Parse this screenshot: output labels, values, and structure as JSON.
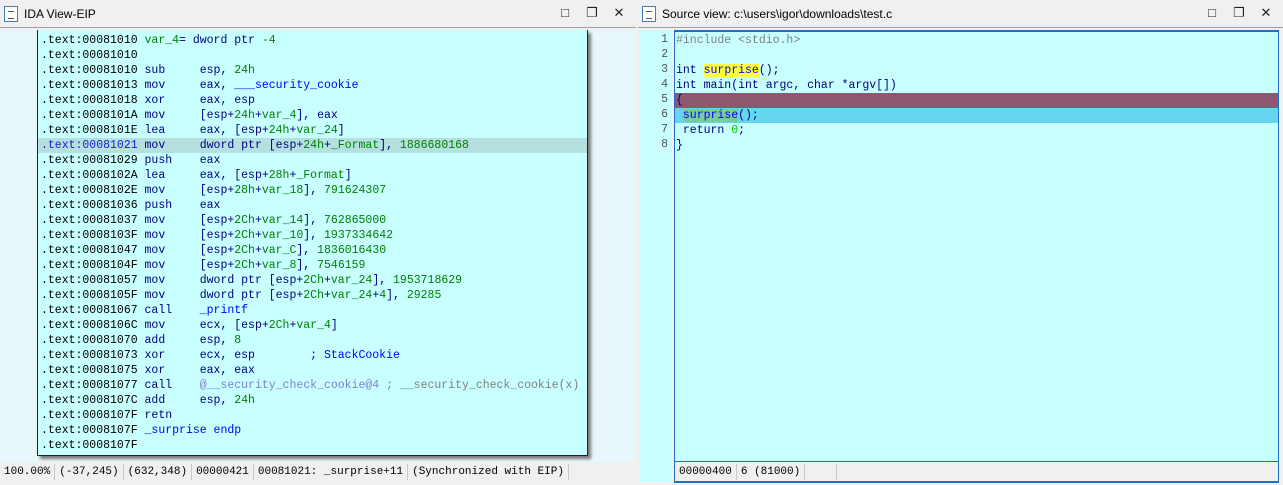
{
  "ida": {
    "title": "IDA View-EIP",
    "lines": [
      {
        "addr": ".text:00081010",
        "mn": "",
        "ops": [
          {
            "t": "var_4",
            "c": "var"
          },
          {
            "t": "= dword ptr ",
            "c": "op"
          },
          {
            "t": "-4",
            "c": "num"
          }
        ]
      },
      {
        "addr": ".text:00081010",
        "mn": "",
        "ops": []
      },
      {
        "addr": ".text:00081010",
        "mn": "sub",
        "ops": [
          {
            "t": "esp, ",
            "c": "op"
          },
          {
            "t": "24h",
            "c": "num"
          }
        ]
      },
      {
        "addr": ".text:00081013",
        "mn": "mov",
        "ops": [
          {
            "t": "eax, ",
            "c": "op"
          },
          {
            "t": "___security_cookie",
            "c": "name"
          }
        ]
      },
      {
        "addr": ".text:00081018",
        "mn": "xor",
        "ops": [
          {
            "t": "eax, esp",
            "c": "op"
          }
        ]
      },
      {
        "addr": ".text:0008101A",
        "mn": "mov",
        "ops": [
          {
            "t": "[esp+",
            "c": "op"
          },
          {
            "t": "24h",
            "c": "num"
          },
          {
            "t": "+",
            "c": "op"
          },
          {
            "t": "var_4",
            "c": "var"
          },
          {
            "t": "], eax",
            "c": "op"
          }
        ]
      },
      {
        "addr": ".text:0008101E",
        "mn": "lea",
        "ops": [
          {
            "t": "eax, [esp+",
            "c": "op"
          },
          {
            "t": "24h",
            "c": "num"
          },
          {
            "t": "+",
            "c": "op"
          },
          {
            "t": "var_24",
            "c": "var"
          },
          {
            "t": "]",
            "c": "op"
          }
        ]
      },
      {
        "addr": ".text:00081021",
        "mn": "mov",
        "hl": true,
        "ops": [
          {
            "t": "dword ptr [esp+",
            "c": "op"
          },
          {
            "t": "24h",
            "c": "num"
          },
          {
            "t": "+",
            "c": "op"
          },
          {
            "t": "_Format",
            "c": "var"
          },
          {
            "t": "], ",
            "c": "op"
          },
          {
            "t": "1886680168",
            "c": "num"
          }
        ]
      },
      {
        "addr": ".text:00081029",
        "mn": "push",
        "ops": [
          {
            "t": "eax",
            "c": "op"
          }
        ]
      },
      {
        "addr": ".text:0008102A",
        "mn": "lea",
        "ops": [
          {
            "t": "eax, [esp+",
            "c": "op"
          },
          {
            "t": "28h",
            "c": "num"
          },
          {
            "t": "+",
            "c": "op"
          },
          {
            "t": "_Format",
            "c": "var"
          },
          {
            "t": "]",
            "c": "op"
          }
        ]
      },
      {
        "addr": ".text:0008102E",
        "mn": "mov",
        "ops": [
          {
            "t": "[esp+",
            "c": "op"
          },
          {
            "t": "28h",
            "c": "num"
          },
          {
            "t": "+",
            "c": "op"
          },
          {
            "t": "var_18",
            "c": "var"
          },
          {
            "t": "], ",
            "c": "op"
          },
          {
            "t": "791624307",
            "c": "num"
          }
        ]
      },
      {
        "addr": ".text:00081036",
        "mn": "push",
        "ops": [
          {
            "t": "eax",
            "c": "op"
          }
        ]
      },
      {
        "addr": ".text:00081037",
        "mn": "mov",
        "ops": [
          {
            "t": "[esp+",
            "c": "op"
          },
          {
            "t": "2Ch",
            "c": "num"
          },
          {
            "t": "+",
            "c": "op"
          },
          {
            "t": "var_14",
            "c": "var"
          },
          {
            "t": "], ",
            "c": "op"
          },
          {
            "t": "762865000",
            "c": "num"
          }
        ]
      },
      {
        "addr": ".text:0008103F",
        "mn": "mov",
        "ops": [
          {
            "t": "[esp+",
            "c": "op"
          },
          {
            "t": "2Ch",
            "c": "num"
          },
          {
            "t": "+",
            "c": "op"
          },
          {
            "t": "var_10",
            "c": "var"
          },
          {
            "t": "], ",
            "c": "op"
          },
          {
            "t": "1937334642",
            "c": "num"
          }
        ]
      },
      {
        "addr": ".text:00081047",
        "mn": "mov",
        "ops": [
          {
            "t": "[esp+",
            "c": "op"
          },
          {
            "t": "2Ch",
            "c": "num"
          },
          {
            "t": "+",
            "c": "op"
          },
          {
            "t": "var_C",
            "c": "var"
          },
          {
            "t": "], ",
            "c": "op"
          },
          {
            "t": "1836016430",
            "c": "num"
          }
        ]
      },
      {
        "addr": ".text:0008104F",
        "mn": "mov",
        "ops": [
          {
            "t": "[esp+",
            "c": "op"
          },
          {
            "t": "2Ch",
            "c": "num"
          },
          {
            "t": "+",
            "c": "op"
          },
          {
            "t": "var_8",
            "c": "var"
          },
          {
            "t": "], ",
            "c": "op"
          },
          {
            "t": "7546159",
            "c": "num"
          }
        ]
      },
      {
        "addr": ".text:00081057",
        "mn": "mov",
        "ops": [
          {
            "t": "dword ptr [esp+",
            "c": "op"
          },
          {
            "t": "2Ch",
            "c": "num"
          },
          {
            "t": "+",
            "c": "op"
          },
          {
            "t": "var_24",
            "c": "var"
          },
          {
            "t": "], ",
            "c": "op"
          },
          {
            "t": "1953718629",
            "c": "num"
          }
        ]
      },
      {
        "addr": ".text:0008105F",
        "mn": "mov",
        "ops": [
          {
            "t": "dword ptr [esp+",
            "c": "op"
          },
          {
            "t": "2Ch",
            "c": "num"
          },
          {
            "t": "+",
            "c": "op"
          },
          {
            "t": "var_24",
            "c": "var"
          },
          {
            "t": "+",
            "c": "op"
          },
          {
            "t": "4",
            "c": "num"
          },
          {
            "t": "], ",
            "c": "op"
          },
          {
            "t": "29285",
            "c": "num"
          }
        ]
      },
      {
        "addr": ".text:00081067",
        "mn": "call",
        "ops": [
          {
            "t": "_printf",
            "c": "name"
          }
        ]
      },
      {
        "addr": ".text:0008106C",
        "mn": "mov",
        "ops": [
          {
            "t": "ecx, [esp+",
            "c": "op"
          },
          {
            "t": "2Ch",
            "c": "num"
          },
          {
            "t": "+",
            "c": "op"
          },
          {
            "t": "var_4",
            "c": "var"
          },
          {
            "t": "]",
            "c": "op"
          }
        ]
      },
      {
        "addr": ".text:00081070",
        "mn": "add",
        "ops": [
          {
            "t": "esp, ",
            "c": "op"
          },
          {
            "t": "8",
            "c": "num"
          }
        ]
      },
      {
        "addr": ".text:00081073",
        "mn": "xor",
        "ops": [
          {
            "t": "ecx, esp        ",
            "c": "op"
          },
          {
            "t": "; StackCookie",
            "c": "name"
          }
        ]
      },
      {
        "addr": ".text:00081075",
        "mn": "xor",
        "ops": [
          {
            "t": "eax, eax",
            "c": "op"
          }
        ]
      },
      {
        "addr": ".text:00081077",
        "mn": "call",
        "ops": [
          {
            "t": "@__security_check_cookie@4",
            "c": "imp"
          },
          {
            "t": " ; __security_check_cookie(x)",
            "c": "cmt"
          }
        ]
      },
      {
        "addr": ".text:0008107C",
        "mn": "add",
        "ops": [
          {
            "t": "esp, ",
            "c": "op"
          },
          {
            "t": "24h",
            "c": "num"
          }
        ]
      },
      {
        "addr": ".text:0008107F",
        "mn": "retn",
        "ops": []
      },
      {
        "addr": ".text:0008107F",
        "mn": "",
        "ops": [
          {
            "t": "_surprise endp",
            "c": "name"
          }
        ]
      },
      {
        "addr": ".text:0008107F",
        "mn": "",
        "ops": []
      }
    ],
    "status": [
      "100.00%",
      "(-37,245)",
      "(632,348)",
      "00000421",
      "00081021: _surprise+11",
      "(Synchronized with EIP)"
    ]
  },
  "source": {
    "title": "Source view: c:\\users\\igor\\downloads\\test.c",
    "lines": [
      {
        "n": "1",
        "parts": [
          {
            "t": "#include <stdio.h>",
            "c": "pp"
          }
        ]
      },
      {
        "n": "2",
        "parts": []
      },
      {
        "n": "3",
        "parts": [
          {
            "t": "int ",
            "c": "kw"
          },
          {
            "t": "surprise",
            "c": "hly"
          },
          {
            "t": "();",
            "c": "tx"
          }
        ]
      },
      {
        "n": "4",
        "parts": [
          {
            "t": "int main(int argc, char *argv[])",
            "c": "tx"
          }
        ]
      },
      {
        "n": "5",
        "state": "cur",
        "marker": "big",
        "parts": [
          {
            "t": "{",
            "c": "tx"
          }
        ]
      },
      {
        "n": "6",
        "state": "step",
        "marker": "dot",
        "parts": [
          {
            "t": " ",
            "c": "tx"
          },
          {
            "t": "surprise",
            "c": "hlg"
          },
          {
            "t": "();",
            "c": "tx"
          }
        ]
      },
      {
        "n": "7",
        "marker": "dot",
        "parts": [
          {
            "t": " return ",
            "c": "tx"
          },
          {
            "t": "0",
            "c": "num"
          },
          {
            "t": ";",
            "c": "tx"
          }
        ]
      },
      {
        "n": "8",
        "marker": "dot",
        "parts": [
          {
            "t": "}",
            "c": "tx"
          }
        ]
      }
    ],
    "status": [
      "00000400",
      "6 (81000)",
      ""
    ]
  },
  "buttons": {
    "maximize": "□",
    "restore": "❐",
    "close": "✕"
  }
}
